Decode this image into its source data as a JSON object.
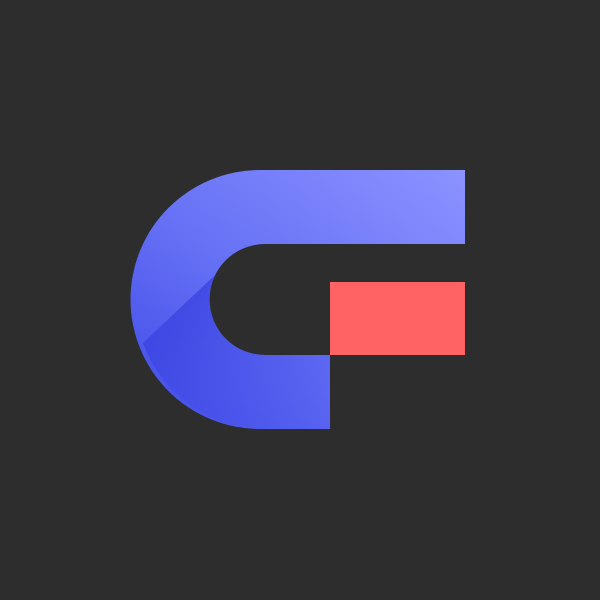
{
  "logo": {
    "icon": "letter-g-logo-icon",
    "colors": {
      "background": "#2d2d2d",
      "arc_light": "#8b93ff",
      "arc_mid": "#6570f5",
      "arc_dark": "#3f48e6",
      "accent_block": "#ff6363"
    }
  }
}
